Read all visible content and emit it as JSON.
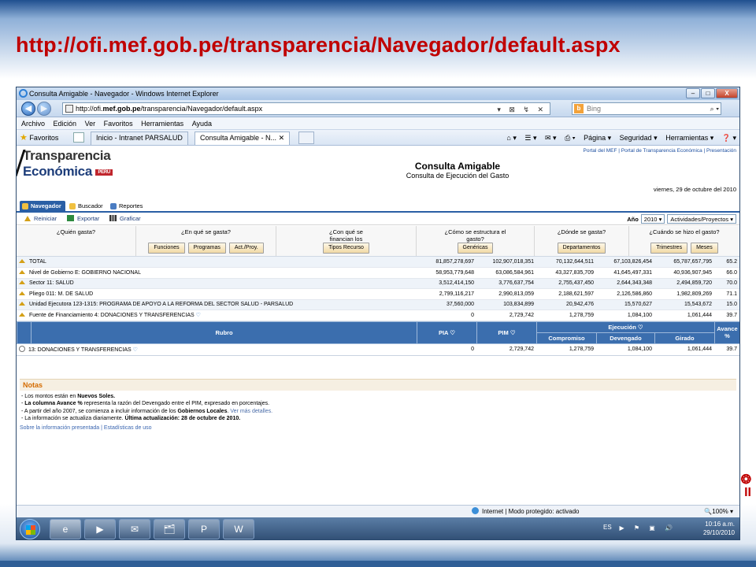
{
  "slide": {
    "title": "http://ofi.mef.gob.pe/transparencia/Navegador/default.aspx"
  },
  "window": {
    "title": "Consulta Amigable - Navegador - Windows Internet Explorer",
    "minimize": "‒",
    "maximize": "□",
    "close": "X"
  },
  "address": {
    "prefix": "http://ofi.",
    "domain": "mef.gob.pe",
    "path": "/transparencia/Navegador/default.aspx",
    "tools": "▾ ⊠ ↯ ✕",
    "search_placeholder": "Bing",
    "search_icon": "b",
    "search_go": "⌕ ▾"
  },
  "menu": [
    "Archivo",
    "Edición",
    "Ver",
    "Favoritos",
    "Herramientas",
    "Ayuda"
  ],
  "favbar": {
    "favoritos": "Favoritos",
    "tab1": "Inicio - Intranet PARSALUD",
    "tab2": "Consulta Amigable - N...",
    "tab2_close": "✕",
    "commands": [
      "⌂ ▾",
      "☰ ▾",
      "✉ ▾",
      "⎙ ▾",
      "Página ▾",
      "Seguridad ▾",
      "Herramientas ▾",
      "❓ ▾"
    ]
  },
  "page": {
    "logo_line1": "Transparencia",
    "logo_line2": "Económica",
    "logo_tag": "PERU",
    "top_links": "Portal del MEF  |  Portal de Transparencia Económica  |  Presentación",
    "title": "Consulta Amigable",
    "subtitle": "Consulta de Ejecución del Gasto",
    "date": "viernes, 29 de octubre del 2010",
    "tabs": [
      "Navegador",
      "Buscador",
      "Reportes"
    ],
    "tools": [
      "Reiniciar",
      "Exportar",
      "Graficar"
    ],
    "year_label": "Año",
    "year_value": "2010",
    "year_arrow": "▾",
    "activity_value": "Actividades/Proyectos",
    "activity_arrow": "▾"
  },
  "questions": [
    {
      "q": "¿Quién gasta?",
      "buttons": []
    },
    {
      "q": "¿En qué se gasta?",
      "buttons": [
        "Funciones",
        "Programas",
        "Act./Proy."
      ]
    },
    {
      "q": "¿Con qué se financian los gastos?",
      "buttons": [
        "Tipos Recurso"
      ]
    },
    {
      "q": "¿Cómo se estructura el gasto?",
      "buttons": [
        "Genéricas"
      ]
    },
    {
      "q": "¿Dónde se gasta?",
      "buttons": [
        "Departamentos"
      ]
    },
    {
      "q": "¿Cuándo se hizo el gasto?",
      "buttons": [
        "Trimestres",
        "Meses"
      ]
    }
  ],
  "hierarchy": [
    {
      "label": "TOTAL",
      "pia": "81,857,278,697",
      "pim": "102,907,018,351",
      "compromiso": "70,132,644,511",
      "devengado": "67,103,826,454",
      "girado": "65,787,657,795",
      "avance": "65.2"
    },
    {
      "label": "Nivel de Gobierno E: GOBIERNO NACIONAL",
      "pia": "58,953,779,648",
      "pim": "63,086,584,961",
      "compromiso": "43,327,835,709",
      "devengado": "41,645,497,331",
      "girado": "40,936,907,945",
      "avance": "66.0"
    },
    {
      "label": "Sector 11: SALUD",
      "pia": "3,512,414,150",
      "pim": "3,776,637,754",
      "compromiso": "2,755,437,450",
      "devengado": "2,644,343,348",
      "girado": "2,494,859,720",
      "avance": "70.0"
    },
    {
      "label": "Pliego 011: M. DE SALUD",
      "pia": "2,799,116,217",
      "pim": "2,990,813,059",
      "compromiso": "2,188,621,597",
      "devengado": "2,126,586,860",
      "girado": "1,982,809,269",
      "avance": "71.1"
    },
    {
      "label": "Unidad Ejecutora 123-1315: PROGRAMA DE APOYO A LA REFORMA DEL SECTOR SALUD - PARSALUD",
      "pia": "37,560,000",
      "pim": "103,834,899",
      "compromiso": "20,942,476",
      "devengado": "15,570,627",
      "girado": "15,543,672",
      "avance": "15.0"
    },
    {
      "label": "Fuente de Financiamiento 4: DONACIONES Y TRANSFERENCIAS",
      "pia": "0",
      "pim": "2,729,742",
      "compromiso": "1,278,759",
      "devengado": "1,084,100",
      "girado": "1,061,444",
      "avance": "39.7"
    }
  ],
  "grid_header": {
    "rubro": "Rubro",
    "pia": "PIA",
    "pim": "PIM",
    "ejecucion": "Ejecución",
    "compromiso": "Compromiso",
    "devengado": "Devengado",
    "girado": "Girado",
    "avance": "Avance",
    "avance_unit": "%"
  },
  "rubro_rows": [
    {
      "label": "13: DONACIONES Y TRANSFERENCIAS",
      "pia": "0",
      "pim": "2,729,742",
      "compromiso": "1,278,759",
      "devengado": "1,084,100",
      "girado": "1,061,444",
      "avance": "39.7"
    }
  ],
  "notes": {
    "title": "Notas",
    "l1a": "- Los montos están en ",
    "l1b": "Nuevos Soles.",
    "l2a": "- ",
    "l2b": "La columna Avance %",
    "l2c": " representa la razón del Devengado entre el PIM, expresado en porcentajes.",
    "l3a": "- A partir del año 2007, se comienza a incluir información de los ",
    "l3b": "Gobiernos Locales",
    "l3c": ". ",
    "l3d": "Ver más detalles.",
    "l4a": "- La información se actualiza diariamente. ",
    "l4b": "Última actualización: 28 de octubre de 2010.",
    "footer": "Sobre la información presentada  |  Estadísticas de uso"
  },
  "status": {
    "text": "Internet | Modo protegido: activado",
    "zoom": "🔍100% ▾"
  },
  "taskbar": {
    "icons": [
      "e",
      "▶",
      "✉",
      "🗂",
      "P",
      "W"
    ],
    "lang": "ES",
    "tray": "▶ ⚑ ▣ 🔊",
    "time": "10:16 a.m.",
    "date": "29/10/2010"
  },
  "corner_logo": "❂\nII"
}
